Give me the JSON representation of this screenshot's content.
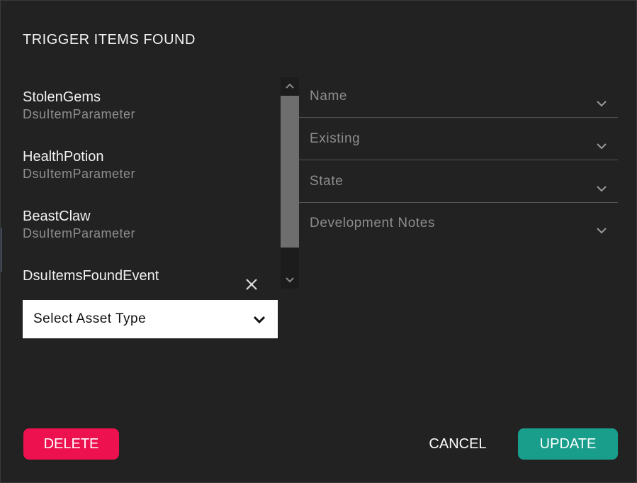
{
  "dialog": {
    "title": "TRIGGER ITEMS FOUND"
  },
  "items": [
    {
      "name": "StolenGems",
      "type": "DsuItemParameter"
    },
    {
      "name": "HealthPotion",
      "type": "DsuItemParameter"
    },
    {
      "name": "BeastClaw",
      "type": "DsuItemParameter"
    },
    {
      "name": "DsuItemsFoundEvent",
      "type": ""
    }
  ],
  "clear_icon": "close-icon",
  "asset_select": {
    "value": "Select Asset Type"
  },
  "fields": {
    "name": "Name",
    "existing": "Existing",
    "state": "State",
    "development_notes": "Development Notes"
  },
  "buttons": {
    "delete": "DELETE",
    "cancel": "CANCEL",
    "update": "UPDATE"
  },
  "colors": {
    "background": "#222222",
    "delete": "#ee1150",
    "update": "#1a9e8c"
  }
}
